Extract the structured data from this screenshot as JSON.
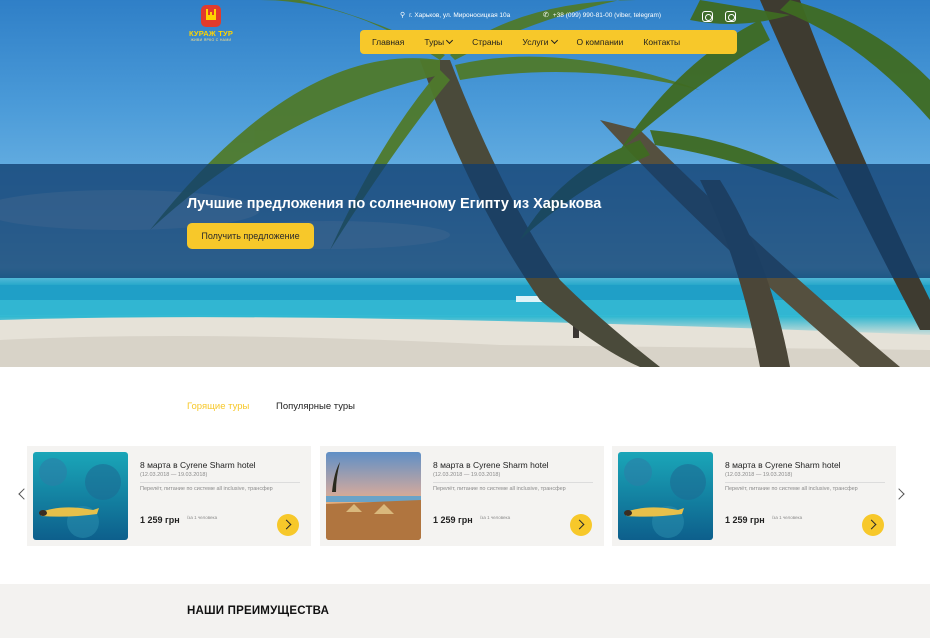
{
  "header": {
    "logo": {
      "brand": "КУРАЖ ТУР",
      "tagline": "ЖИВИ ЯРКО С НАМИ"
    },
    "address": "г. Харьков, ул. Мироносицкая 10а",
    "phone": "+38 (099) 990-81-00 (viber, telegram)",
    "address_icon": "location-pin-icon",
    "phone_icon": "phone-icon",
    "social": [
      "facebook-icon",
      "instagram-icon"
    ],
    "nav": [
      {
        "label": "Главная"
      },
      {
        "label": "Туры",
        "has_dropdown": true
      },
      {
        "label": "Страны"
      },
      {
        "label": "Услуги",
        "has_dropdown": true
      },
      {
        "label": "О компании"
      },
      {
        "label": "Контакты"
      }
    ]
  },
  "hero": {
    "title": "Лучшие предложения по солнечному Египту из Харькова",
    "cta_label": "Получить предложение"
  },
  "tabs": [
    {
      "label": "Горящие туры",
      "active": true
    },
    {
      "label": "Популярные туры",
      "active": false
    }
  ],
  "tours": [
    {
      "title": "8 марта в Cyrene Sharm hotel",
      "dates": "(12.03.2018 — 19.03.2018)",
      "description": "Перелёт, питание по системе all inclusive, трансфер",
      "price": "1 259 грн",
      "per": "/за 1 человека",
      "image": "snorkeling-diver-photo"
    },
    {
      "title": "8 марта в Cyrene Sharm hotel",
      "dates": "(12.03.2018 — 19.03.2018)",
      "description": "Перелёт, питание по системе all inclusive, трансфер",
      "price": "1 259 грн",
      "per": "/за 1 человека",
      "image": "beach-sunset-photo"
    },
    {
      "title": "8 марта в Cyrene Sharm hotel",
      "dates": "(12.03.2018 — 19.03.2018)",
      "description": "Перелёт, питание по системе all inclusive, трансфер",
      "price": "1 259 грн",
      "per": "/за 1 человека",
      "image": "snorkeling-diver-photo"
    }
  ],
  "advantages": {
    "title": "НАШИ ПРЕИМУЩЕСТВА"
  },
  "colors": {
    "accent": "#f7c82a",
    "banner": "#103e70",
    "card_bg": "#f4f3f1"
  }
}
